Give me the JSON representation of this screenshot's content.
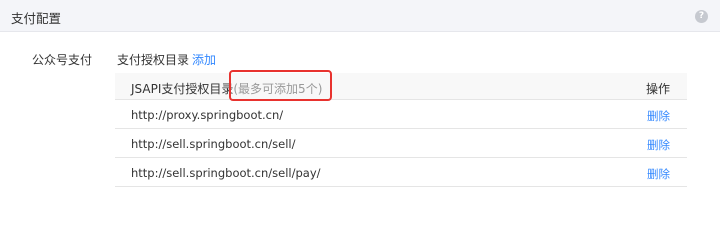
{
  "header": {
    "title": "支付配置",
    "help_glyph": "?"
  },
  "section": {
    "label": "公众号支付",
    "dir_label": "支付授权目录",
    "add_label": "添加"
  },
  "table": {
    "col_name": "JSAPI支付授权目录",
    "col_hint": "(最多可添加5个)",
    "col_op": "操作",
    "rows": [
      {
        "url": "http://proxy.springboot.cn/",
        "action": "删除"
      },
      {
        "url": "http://sell.springboot.cn/sell/",
        "action": "删除"
      },
      {
        "url": "http://sell.springboot.cn/sell/pay/",
        "action": "删除"
      }
    ]
  },
  "colors": {
    "link": "#3388ff",
    "highlight": "#e8322e",
    "header_bg": "#f4f5f9"
  },
  "icons": {
    "help": "question-circle-icon"
  }
}
